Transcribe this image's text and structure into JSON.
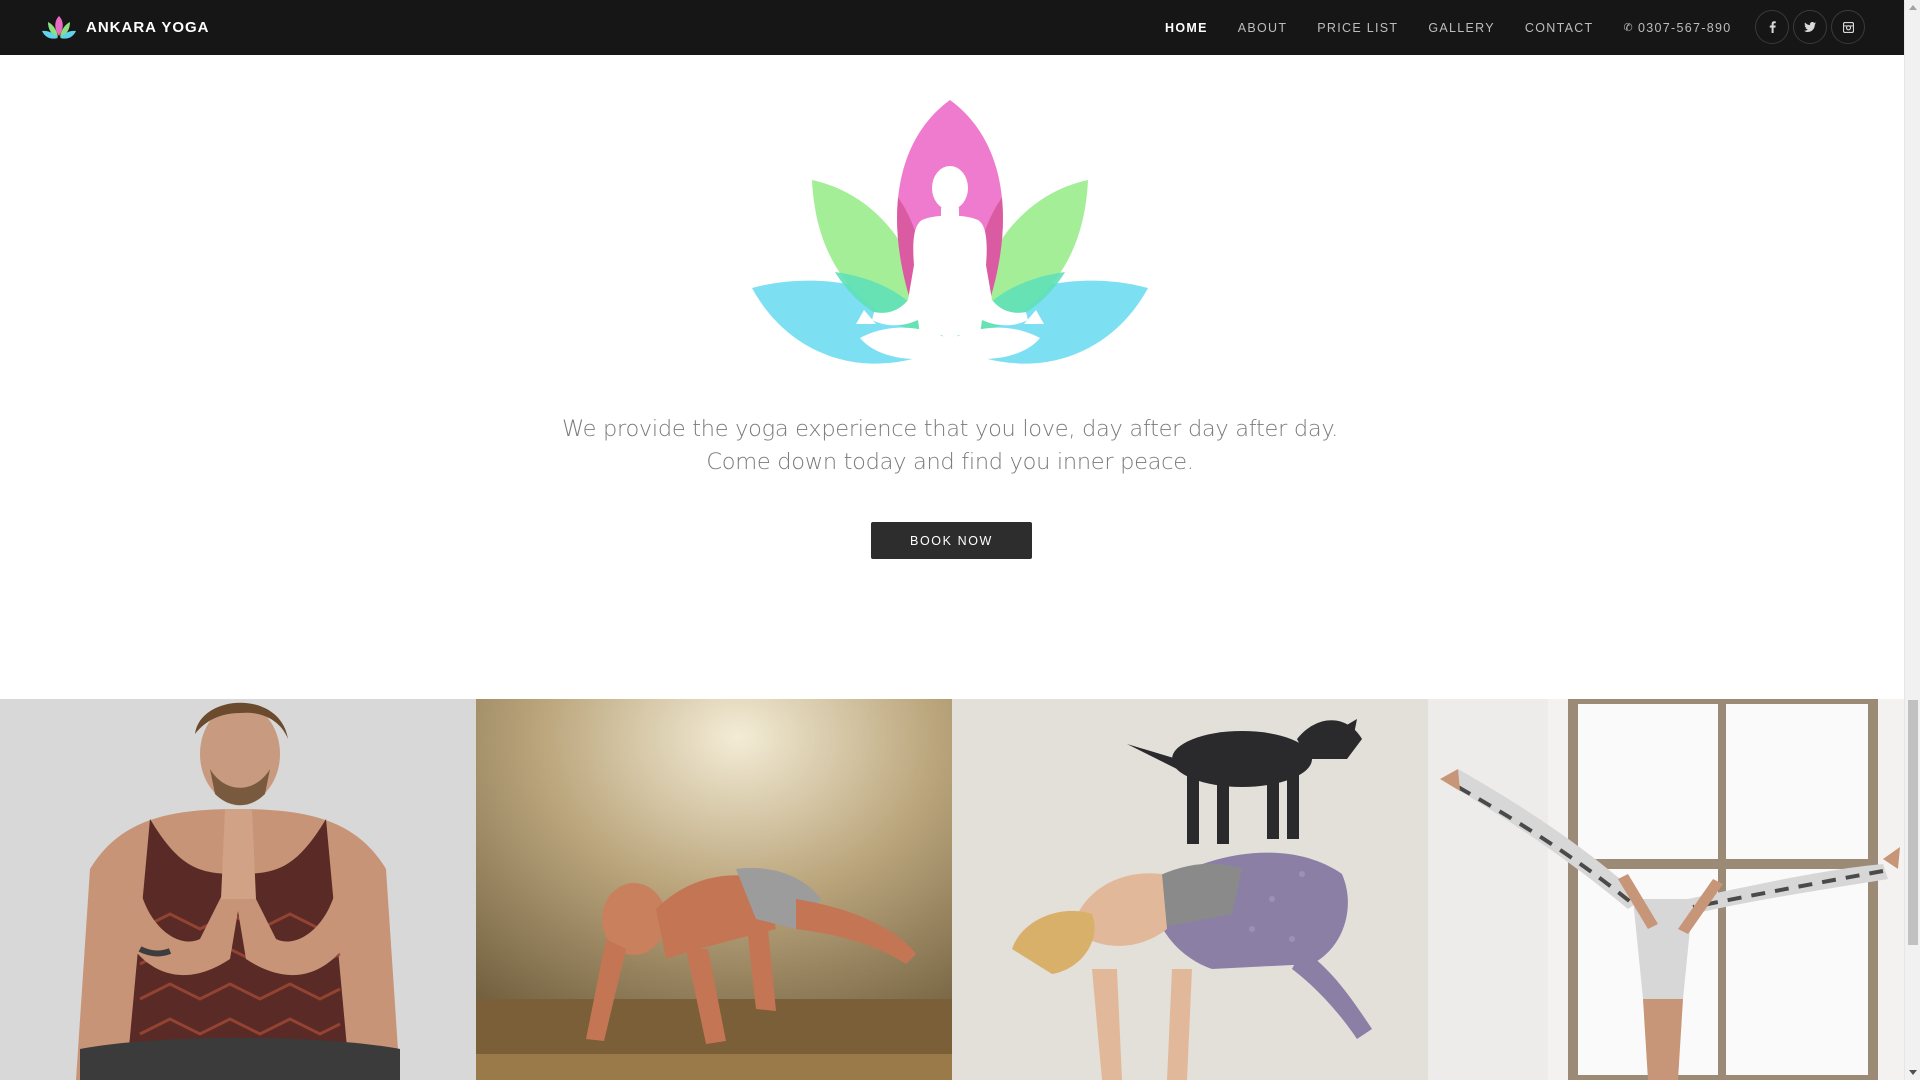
{
  "brand": {
    "name": "ANKARA YOGA",
    "logo_icon": "lotus-icon"
  },
  "nav": {
    "links": [
      {
        "label": "HOME",
        "active": true
      },
      {
        "label": "ABOUT",
        "active": false
      },
      {
        "label": "PRICE LIST",
        "active": false
      },
      {
        "label": "GALLERY",
        "active": false
      },
      {
        "label": "CONTACT",
        "active": false
      }
    ],
    "phone": "0307-567-890",
    "phone_icon": "phone-icon",
    "socials": [
      "facebook-icon",
      "twitter-icon",
      "instagram-icon"
    ]
  },
  "hero": {
    "logo_icon": "meditating-lotus-logo",
    "tagline_line1": "We provide the yoga experience that you love, day after day after day.",
    "tagline_line2": "Come down today and find you inner peace.",
    "cta_label": "BOOK NOW"
  },
  "gallery": {
    "photos": [
      {
        "subject": "man-praying-hands-photo"
      },
      {
        "subject": "man-arm-balance-photo"
      },
      {
        "subject": "woman-crow-pose-with-goat-photo"
      },
      {
        "subject": "woman-headstand-split-photo"
      }
    ]
  },
  "colors": {
    "navbar": "#161616",
    "lotus_pink": "#ec6fc9",
    "lotus_green": "#93ec88",
    "lotus_blue": "#6cdcf0",
    "button": "#2d2d2d"
  }
}
